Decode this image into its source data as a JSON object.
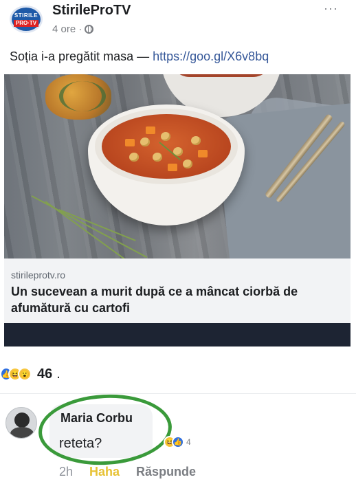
{
  "header": {
    "logo_line1": "STIRILE",
    "logo_line2": "PRO·TV",
    "page_name": "StirileProTV",
    "time": "4 ore ·",
    "more": "···"
  },
  "post": {
    "text": "Soția i-a pregătit masa — ",
    "link": "https://goo.gl/X6v8bq"
  },
  "preview": {
    "domain": "stirileprotv.ro",
    "headline": "Un sucevean a murit după ce a mâncat ciorbă de afumătură cu cartofi"
  },
  "reactions": {
    "icons": [
      "like-icon",
      "haha-icon",
      "wow-icon"
    ],
    "count": "46",
    "dot": "."
  },
  "comment": {
    "author": "Maria Corbu",
    "text": "reteta?",
    "reaction_count": "4",
    "reaction_icons": [
      "haha-icon",
      "like-icon"
    ],
    "time": "2h",
    "haha_label": "Haha",
    "reply_label": "Răspunde"
  },
  "colors": {
    "link": "#365899",
    "haha": "#e7c235",
    "highlight_ring": "#3a9a3a",
    "preview_bar": "#1d2433"
  }
}
